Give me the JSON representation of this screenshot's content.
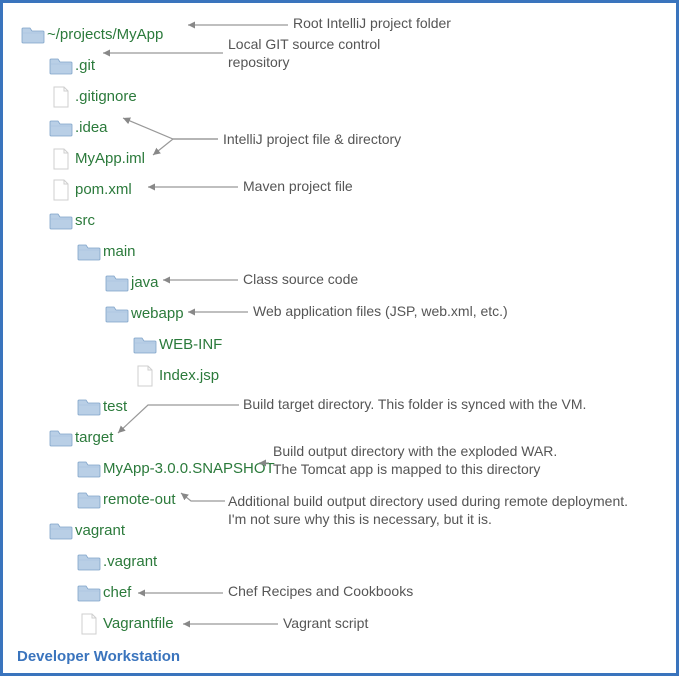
{
  "caption": "Developer Workstation",
  "tree": [
    {
      "id": "root",
      "depth": 0,
      "icon": "folder",
      "label": "~/projects/MyApp"
    },
    {
      "id": "git",
      "depth": 1,
      "icon": "folder",
      "label": ".git"
    },
    {
      "id": "gitignore",
      "depth": 1,
      "icon": "file",
      "label": ".gitignore"
    },
    {
      "id": "idea",
      "depth": 1,
      "icon": "folder",
      "label": ".idea"
    },
    {
      "id": "iml",
      "depth": 1,
      "icon": "file",
      "label": "MyApp.iml"
    },
    {
      "id": "pom",
      "depth": 1,
      "icon": "file",
      "label": "pom.xml"
    },
    {
      "id": "src",
      "depth": 1,
      "icon": "folder",
      "label": "src"
    },
    {
      "id": "main",
      "depth": 2,
      "icon": "folder",
      "label": "main"
    },
    {
      "id": "java",
      "depth": 3,
      "icon": "folder",
      "label": "java"
    },
    {
      "id": "webapp",
      "depth": 3,
      "icon": "folder",
      "label": "webapp"
    },
    {
      "id": "webinf",
      "depth": 4,
      "icon": "folder",
      "label": "WEB-INF"
    },
    {
      "id": "indexjsp",
      "depth": 4,
      "icon": "file",
      "label": "Index.jsp"
    },
    {
      "id": "test",
      "depth": 2,
      "icon": "folder",
      "label": "test"
    },
    {
      "id": "target",
      "depth": 1,
      "icon": "folder",
      "label": "target"
    },
    {
      "id": "snapshot",
      "depth": 2,
      "icon": "folder",
      "label": "MyApp-3.0.0.SNAPSHOT"
    },
    {
      "id": "remoteout",
      "depth": 2,
      "icon": "folder",
      "label": "remote-out"
    },
    {
      "id": "vagrant",
      "depth": 1,
      "icon": "folder",
      "label": "vagrant"
    },
    {
      "id": "dotvagrant",
      "depth": 2,
      "icon": "folder",
      "label": ".vagrant"
    },
    {
      "id": "chef",
      "depth": 2,
      "icon": "folder",
      "label": "chef"
    },
    {
      "id": "vagrantfile",
      "depth": 2,
      "icon": "file",
      "label": "Vagrantfile"
    }
  ],
  "notes": {
    "root": "Root IntelliJ project folder",
    "git": "Local GIT source control repository",
    "idea": "IntelliJ project file & directory",
    "pom": "Maven project file",
    "java": "Class source code",
    "webapp": "Web application files (JSP, web.xml, etc.)",
    "test": "Build target directory. This folder is synced with the VM.",
    "snapshot": "Build output directory with the exploded WAR. The Tomcat app is mapped to this directory",
    "remoteout": "Additional build output directory used during remote deployment. I'm not sure why this is necessary, but it is.",
    "chef": "Chef Recipes and Cookbooks",
    "vagrantfile": "Vagrant script"
  }
}
